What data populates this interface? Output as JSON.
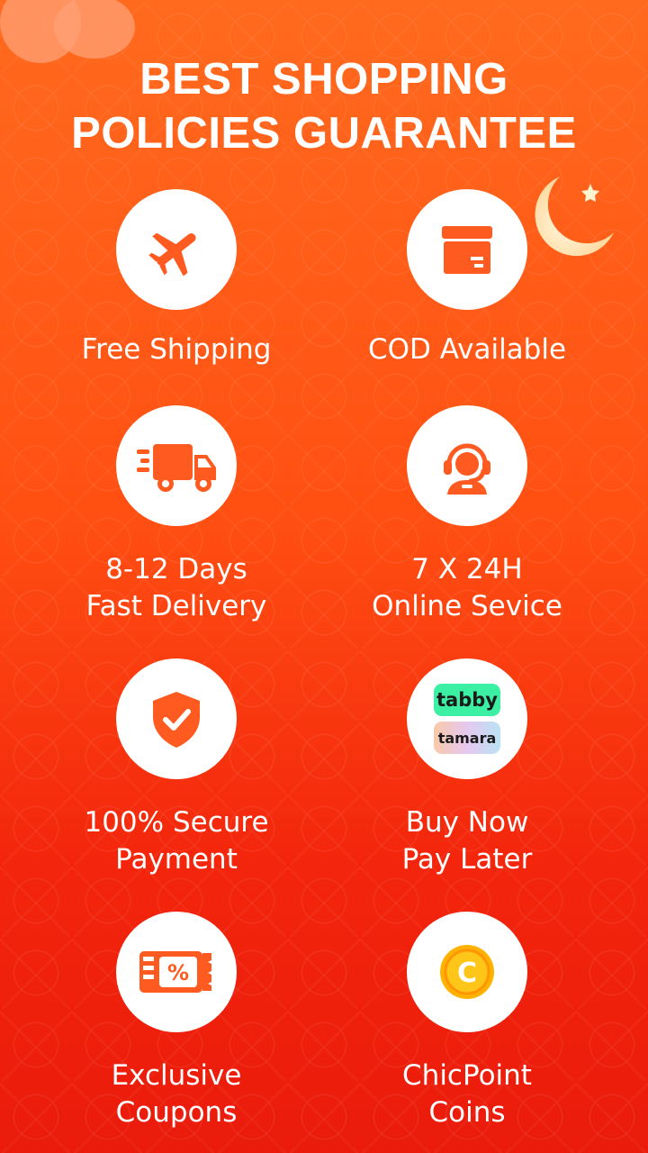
{
  "header": {
    "title_line1": "BEST SHOPPING",
    "title_line2": "POLICIES GUARANTEE"
  },
  "colors": {
    "background_top": "#ff6a1e",
    "background_bottom": "#ea1b0b",
    "icon_accent": "#ff5a1f",
    "circle_bg": "#ffffff"
  },
  "features": [
    {
      "icon": "airplane-icon",
      "line1": "Free Shipping",
      "line2": ""
    },
    {
      "icon": "package-box-icon",
      "line1": "COD Available",
      "line2": ""
    },
    {
      "icon": "delivery-truck-icon",
      "line1": "8-12 Days",
      "line2": "Fast Delivery"
    },
    {
      "icon": "customer-service-headset-icon",
      "line1": "7 X 24H",
      "line2": "Online Sevice"
    },
    {
      "icon": "security-shield-check-icon",
      "line1": "100% Secure",
      "line2": "Payment"
    },
    {
      "icon": "bnpl-logos-icon",
      "line1": "Buy Now",
      "line2": "Pay Later",
      "logo_top": "tabby",
      "logo_bottom": "tamara"
    },
    {
      "icon": "coupon-ticket-icon",
      "line1": "Exclusive",
      "line2": "Coupons",
      "badge": "%"
    },
    {
      "icon": "coin-icon",
      "line1": "ChicPoint",
      "line2": "Coins",
      "badge": "C"
    }
  ]
}
